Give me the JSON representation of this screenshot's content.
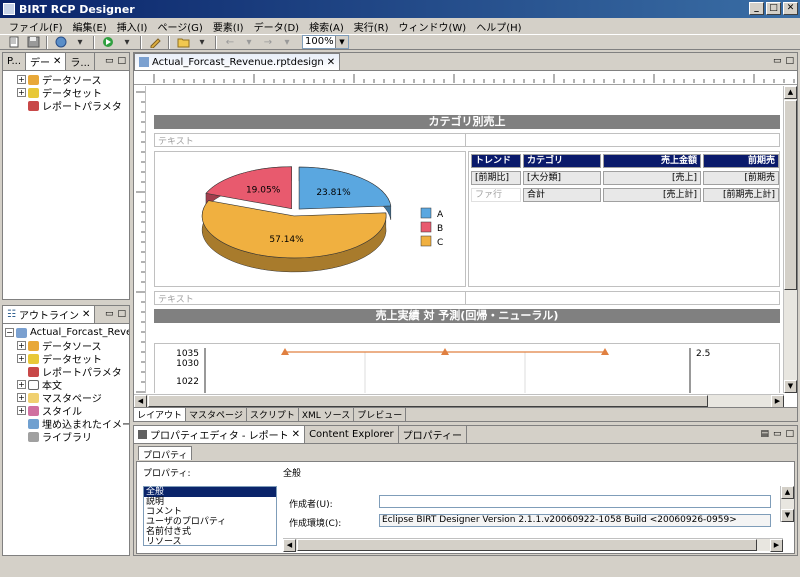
{
  "window": {
    "title": "BIRT RCP Designer"
  },
  "menu": [
    "ファイル(F)",
    "編集(E)",
    "挿入(I)",
    "ページ(G)",
    "要素(I)",
    "データ(D)",
    "検索(A)",
    "実行(R)",
    "ウィンドウ(W)",
    "ヘルプ(H)"
  ],
  "toolbar": {
    "zoom": "100%"
  },
  "data_explorer": {
    "tabs": [
      "P...",
      "デー",
      "ラ..."
    ],
    "items": [
      {
        "label": "データソース",
        "expander": "+"
      },
      {
        "label": "データセット",
        "expander": "+"
      },
      {
        "label": "レポートパラメタ",
        "expander": ""
      }
    ]
  },
  "outline": {
    "tab": "アウトライン",
    "root": "Actual_Forcast_Revenu",
    "items": [
      {
        "label": "データソース",
        "expander": "+"
      },
      {
        "label": "データセット",
        "expander": "+"
      },
      {
        "label": "レポートパラメタ",
        "expander": ""
      },
      {
        "label": "本文",
        "expander": "+"
      },
      {
        "label": "マスタページ",
        "expander": "+"
      },
      {
        "label": "スタイル",
        "expander": "+"
      },
      {
        "label": "埋め込まれたイメー",
        "expander": ""
      },
      {
        "label": "ライブラリ",
        "expander": ""
      }
    ]
  },
  "editor": {
    "tab": "Actual_Forcast_Revenue.rptdesign",
    "section1_title": "カテゴリ別売上",
    "text_placeholder": "テキスト",
    "text_placeholder2": "テキスト",
    "section2_title": "売上実績 対 予測(回帰・ニューラル)",
    "table": {
      "headers": [
        "トレンド",
        "カテゴリ",
        "売上金額",
        "前期売"
      ],
      "row1": [
        "[前期比]",
        "[大分類]",
        "[売上]",
        "[前期売"
      ],
      "row2": [
        "ファ行",
        "合計",
        "[売上計]",
        "[前期売上計]"
      ]
    },
    "bottom_tabs": [
      "レイアウト",
      "マスタページ",
      "スクリプト",
      "XML ソース",
      "プレビュー"
    ]
  },
  "chart_data": [
    {
      "type": "pie",
      "categories": [
        "A",
        "B",
        "C"
      ],
      "values": [
        23.81,
        19.05,
        57.14
      ],
      "labels": [
        "23.81%",
        "19.05%",
        "57.14%"
      ],
      "colors": [
        "#5aa7e0",
        "#e85a6e",
        "#f0b040"
      ],
      "legend": "right"
    },
    {
      "type": "line",
      "y_left_ticks": [
        "1035",
        "1030",
        "1022"
      ],
      "y_right_ticks": [
        "2.5"
      ],
      "series_color": "#e08040"
    }
  ],
  "properties": {
    "tabs": [
      "プロパティエディタ - レポート",
      "Content Explorer",
      "プロパティー"
    ],
    "subtab": "プロパティ",
    "prop_label": "プロパティ:",
    "prop_value": "全般",
    "list": [
      "全般",
      "説明",
      "コメント",
      "ユーザのプロパティ",
      "名前付き式",
      "リソース"
    ],
    "author_label": "作成者(U):",
    "author_value": "",
    "env_label": "作成環境(C):",
    "env_value": "Eclipse BIRT Designer Version 2.1.1.v20060922-1058 Build <20060926-0959>"
  }
}
